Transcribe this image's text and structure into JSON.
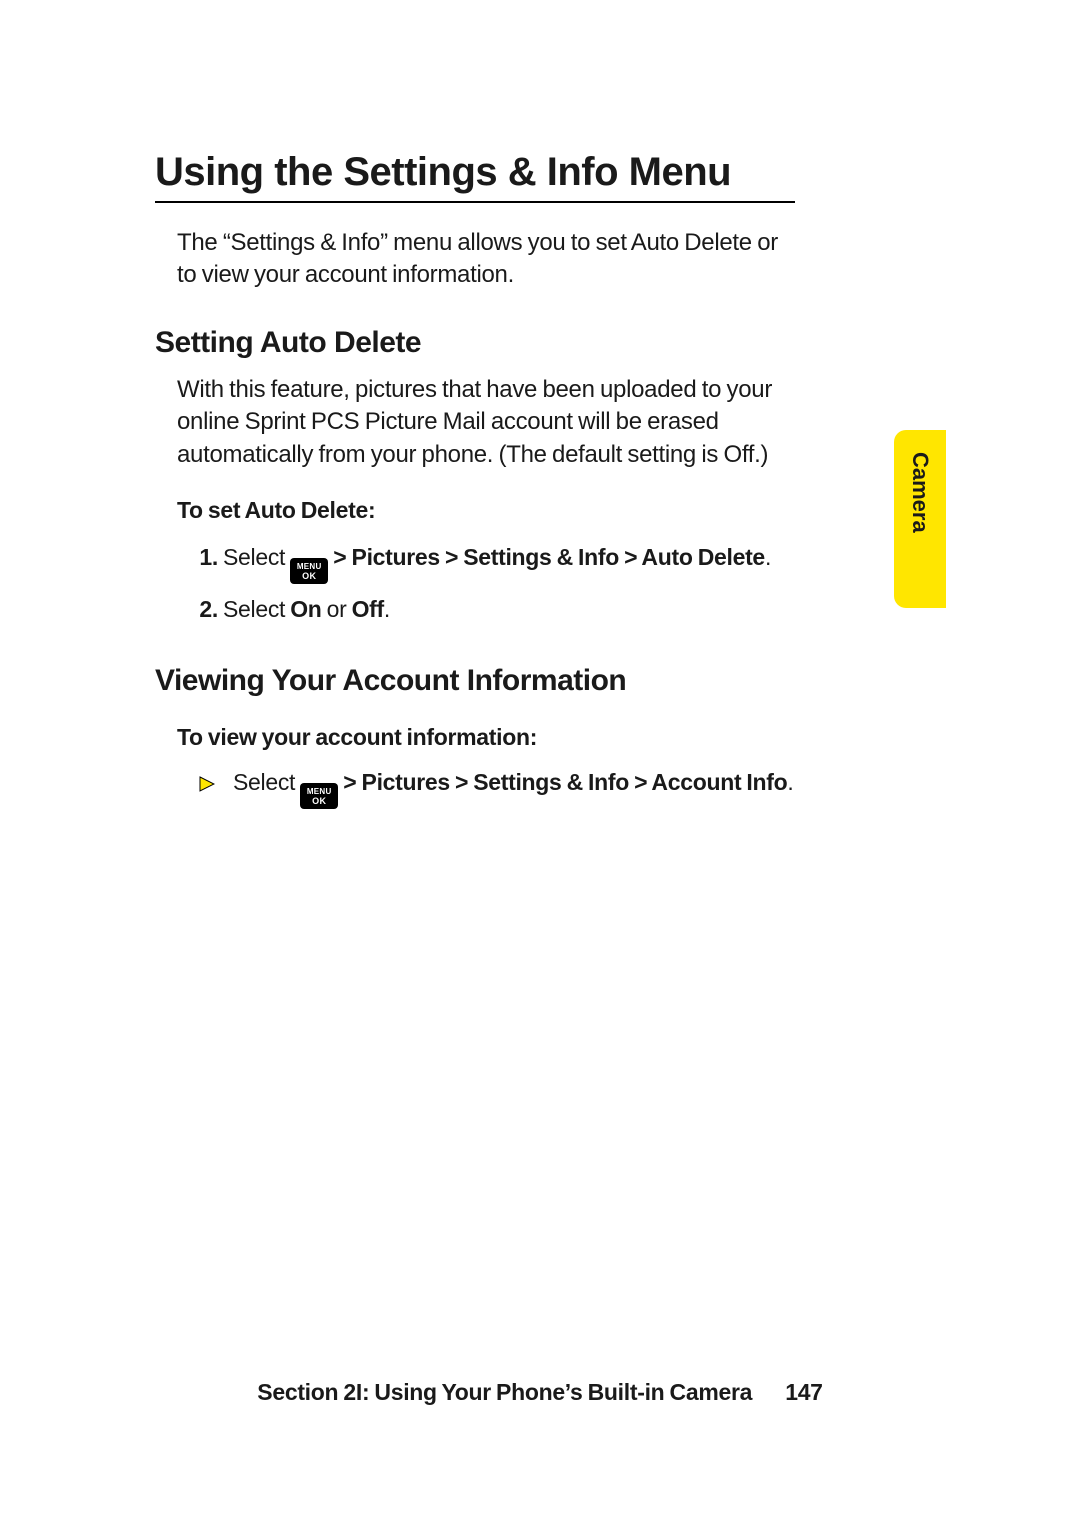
{
  "title": "Using the Settings & Info Menu",
  "intro": "The “Settings & Info” menu allows you to set Auto Delete or to view your account information.",
  "sub1": {
    "heading": "Setting Auto Delete",
    "body": "With this feature, pictures that have been uploaded to your online Sprint PCS Picture Mail account will be erased automatically from your phone. (The default setting is Off.)",
    "leadin": "To set Auto Delete:",
    "step1_pre": "Select ",
    "step1_path": " > Pictures > Settings & Info > Auto Delete",
    "step1_end": ".",
    "step2_pre": "Select ",
    "step2_on": "On",
    "step2_mid": " or ",
    "step2_off": "Off",
    "step2_end": "."
  },
  "sub2": {
    "heading": "Viewing Your Account Information",
    "leadin": "To view your account information:",
    "bullet_pre": "Select ",
    "bullet_path": " > Pictures > Settings & Info > Account Info",
    "bullet_end": "."
  },
  "key": {
    "line1": "MENU",
    "line2": "OK"
  },
  "sidetab": "Camera",
  "footer": {
    "section": "Section 2I: Using Your Phone’s Built-in Camera",
    "page": "147"
  }
}
